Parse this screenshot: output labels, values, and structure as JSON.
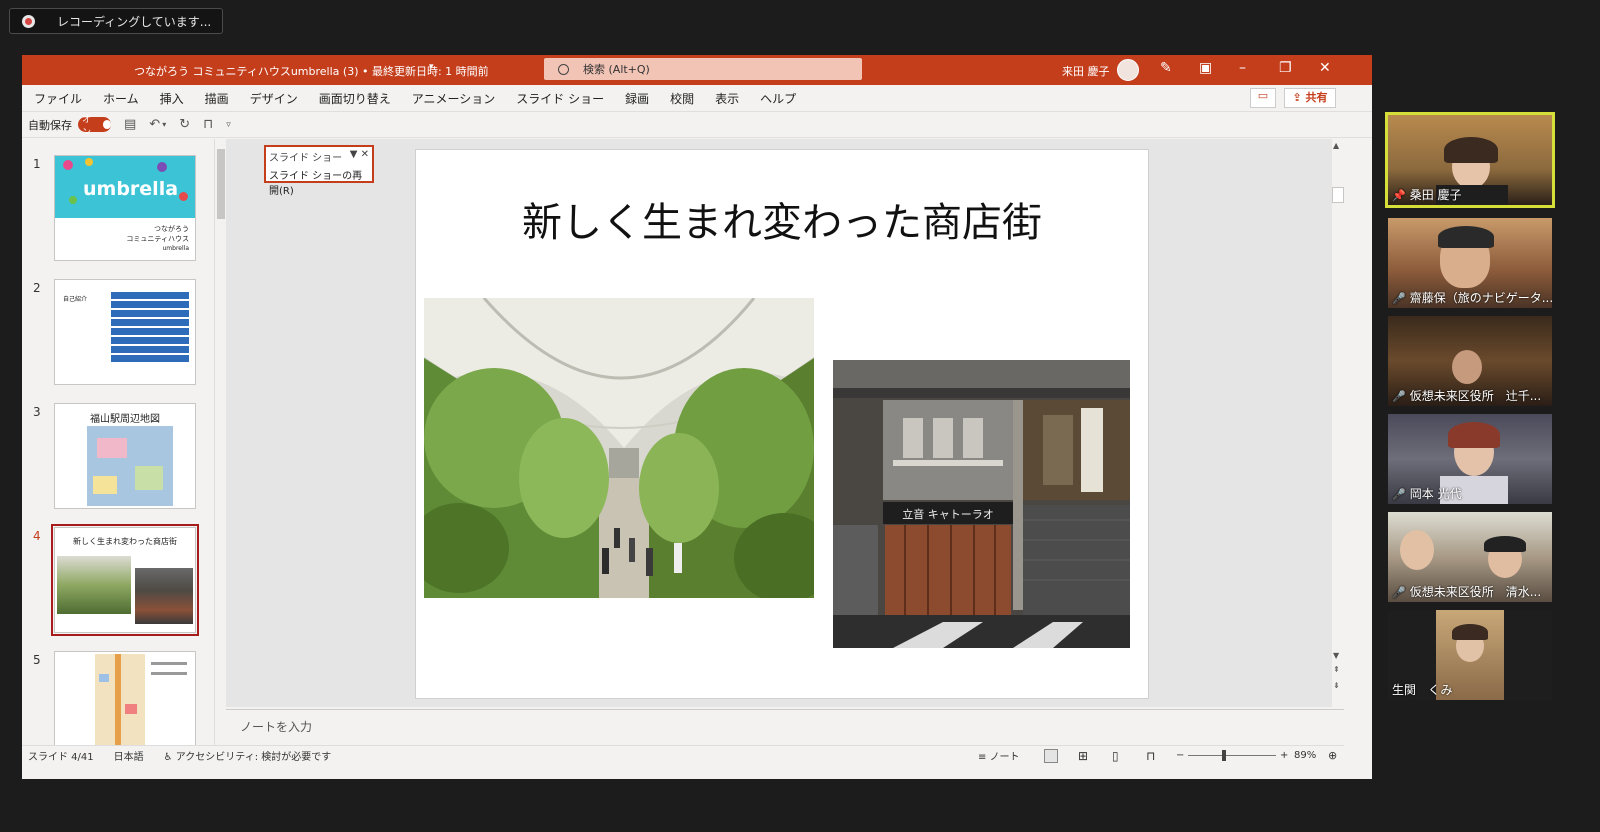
{
  "recording": {
    "label": "レコーディングしています..."
  },
  "ppt": {
    "titlebar": {
      "document": "つながろう コミュニティハウスumbrella (3) • 最終更新日時: 1 時間前",
      "search": "検索 (Alt+Q)",
      "user": "来田 慶子"
    },
    "menu": [
      "ファイル",
      "ホーム",
      "挿入",
      "描画",
      "デザイン",
      "画面切り替え",
      "アニメーション",
      "スライド ショー",
      "録画",
      "校閲",
      "表示",
      "ヘルプ"
    ],
    "share_label": "共有",
    "autosave": {
      "label": "自動保存",
      "state": "オン"
    },
    "slideshow_popup": {
      "title": "スライド ショー",
      "resume": "スライド ショーの再開(R)"
    },
    "thumbnails": [
      {
        "num": "1",
        "title": "umbrella",
        "lines": [
          "つながろう",
          "コミュニティハウス",
          "umbrella"
        ]
      },
      {
        "num": "2",
        "heading": "自己紹介"
      },
      {
        "num": "3",
        "title": "福山駅周辺地図"
      },
      {
        "num": "4",
        "title": "新しく生まれ変わった商店街"
      },
      {
        "num": "5"
      }
    ],
    "slide": {
      "title": "新しく生まれ変わった商店街",
      "sign_text": "立音 キャトーラオ"
    },
    "notes_placeholder": "ノートを入力",
    "status": {
      "slide_pos": "スライド 4/41",
      "language": "日本語",
      "accessibility": "アクセシビリティ: 検討が必要です",
      "notes_btn": "ノート",
      "zoom": "89%"
    }
  },
  "participants": [
    {
      "name": "桑田 慶子",
      "active": true
    },
    {
      "name": "齋藤保（旅のナビゲータ...",
      "muted": true
    },
    {
      "name": "仮想未来区役所　辻千...",
      "muted": true
    },
    {
      "name": "岡本 光代",
      "muted": true
    },
    {
      "name": "仮想未来区役所　清水...",
      "muted": true
    },
    {
      "name": "生関　くみ"
    }
  ]
}
